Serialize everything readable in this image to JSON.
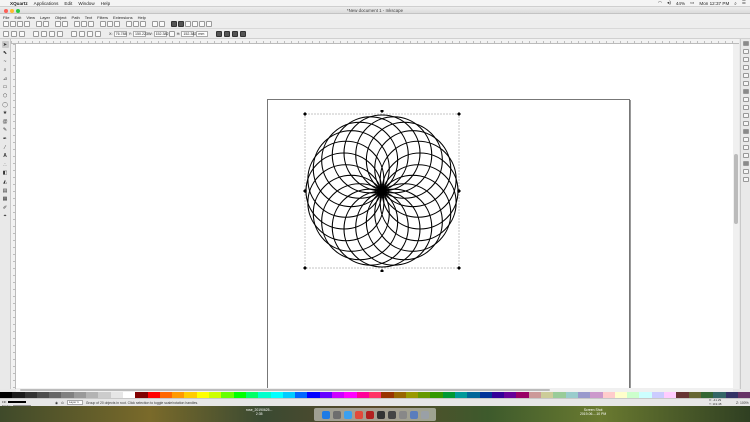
{
  "mac_menubar": {
    "apple_glyph": "",
    "app_name": "XQuartz",
    "items": [
      "Applications",
      "Edit",
      "Window",
      "Help"
    ],
    "battery": "44%",
    "clock": "Mon 12:37 PM"
  },
  "window": {
    "title": "*New document 1 - Inkscape"
  },
  "app_menu": [
    "File",
    "Edit",
    "View",
    "Layer",
    "Object",
    "Path",
    "Text",
    "Filters",
    "Extensions",
    "Help"
  ],
  "tool_controls": {
    "x_label": "X:",
    "x_value": "76.788",
    "y_label": "Y:",
    "y_value": "150.223",
    "w_label": "W:",
    "w_value": "152.382",
    "h_label": "H:",
    "h_value": "152.382",
    "unit": "mm"
  },
  "status_bar": {
    "fill_label": "Fill:",
    "stroke_label": "Stroke:",
    "layer": "Layer 1",
    "message": "Group of 20 objects in root. Click selection to toggle scale/rotation handles.",
    "coords_x": "X: -41.29",
    "coords_y": "Y: 119.48",
    "zoom": "Z: 100%"
  },
  "dock_files": [
    {
      "name": "rose_20190625...",
      "sub": "2:35"
    },
    {
      "name": "Screen Shot",
      "sub": "2019-06-...10 PM"
    }
  ],
  "colors": {
    "canvas": "#ffffff",
    "page_border": "#777777",
    "artwork": "#000000"
  },
  "icons": {
    "left_tools": [
      "selector-icon",
      "node-icon",
      "tweak-icon",
      "zoom-icon",
      "measure-icon",
      "rectangle-icon",
      "3dbox-icon",
      "ellipse-icon",
      "star-icon",
      "spiral-icon",
      "pencil-icon",
      "pen-icon",
      "calligraphy-icon",
      "text-icon",
      "spray-icon",
      "eraser-icon",
      "bucket-icon",
      "gradient-icon",
      "mesh-icon",
      "dropper-icon",
      "connector-icon"
    ]
  }
}
